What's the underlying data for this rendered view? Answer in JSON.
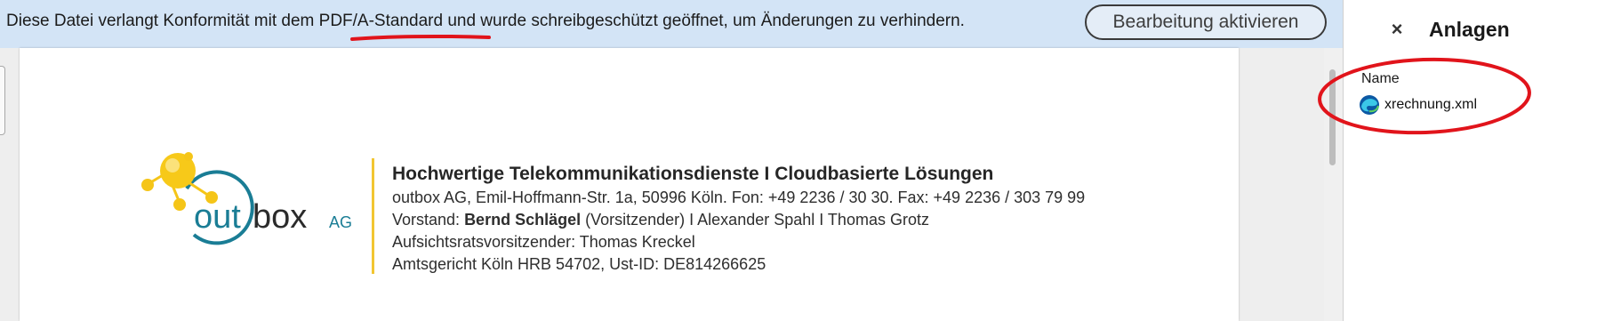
{
  "infobar": {
    "text_before": "Diese Datei verlangt Konformität mit dem ",
    "standard": "PDF/A-Standard",
    "text_after": " und wurde schreibgeschützt geöffnet, um Änderungen zu verhindern.",
    "enable_button": "Bearbeitung aktivieren",
    "annotation_color": "#e1141b"
  },
  "document": {
    "headline": "Hochwertige Telekommunikationsdienste I Cloudbasierte Lösungen",
    "address_line": "outbox AG, Emil-Hoffmann-Str. 1a, 50996 Köln. Fon: +49 2236 / 30 30. Fax: +49 2236 / 303 79 99",
    "board_label": "Vorstand: ",
    "board_chair": "Bernd Schlägel",
    "board_rest": " (Vorsitzender) I Alexander Spahl I Thomas Grotz",
    "supervisory": "Aufsichtsratsvorsitzender: Thomas Kreckel",
    "register": "Amtsgericht Köln HRB 54702, Ust-ID: DE814266625",
    "logo": {
      "word1": "out",
      "word2": "box",
      "suffix": "AG",
      "icon": "outbox-logo-molecule-icon"
    }
  },
  "attachments_panel": {
    "close_label": "×",
    "title": "Anlagen",
    "column_header": "Name",
    "files": [
      {
        "name": "xrechnung.xml",
        "icon": "edge-browser-icon"
      }
    ]
  }
}
